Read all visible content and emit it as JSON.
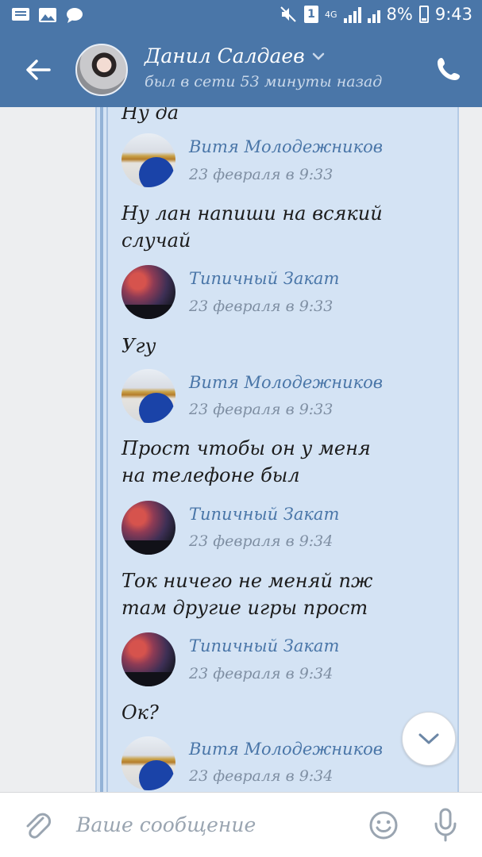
{
  "status_bar": {
    "sim_label": "1",
    "network": "4G",
    "battery_percent": "8%",
    "time": "9:43"
  },
  "header": {
    "title": "Данил Салдаев",
    "subtitle": "был в сети 53 минуты назад"
  },
  "messages": {
    "top_partial_text": "Ну да",
    "items": [
      {
        "author": "Витя Молодежников",
        "date": "23 февраля в 9:33",
        "text": "Ну лан напиши на всякий случай",
        "avatar": "vitya"
      },
      {
        "author": "Типичный Закат",
        "date": "23 февраля в 9:33",
        "text": "Угу",
        "avatar": "zakat"
      },
      {
        "author": "Витя Молодежников",
        "date": "23 февраля в 9:33",
        "text": "Прост чтобы он у меня на телефоне был",
        "avatar": "vitya"
      },
      {
        "author": "Типичный Закат",
        "date": "23 февраля в 9:34",
        "text": "Ток ничего не меняй пж там другие игры прост",
        "avatar": "zakat"
      },
      {
        "author": "Типичный Закат",
        "date": "23 февраля в 9:34",
        "text": "Ок?",
        "avatar": "zakat"
      },
      {
        "author": "Витя Молодежников",
        "date": "23 февраля в 9:34",
        "text": "",
        "avatar": "vitya"
      }
    ]
  },
  "composer": {
    "placeholder": "Ваше сообщение"
  },
  "icons": {
    "back": "arrow-left-icon",
    "call": "phone-icon",
    "attach": "paperclip-icon",
    "emoji": "smile-icon",
    "voice": "microphone-icon",
    "scroll": "chevron-down-icon"
  },
  "colors": {
    "brand": "#4a76a8",
    "forward_bg": "#d4e3f4",
    "author": "#4a76a8"
  }
}
